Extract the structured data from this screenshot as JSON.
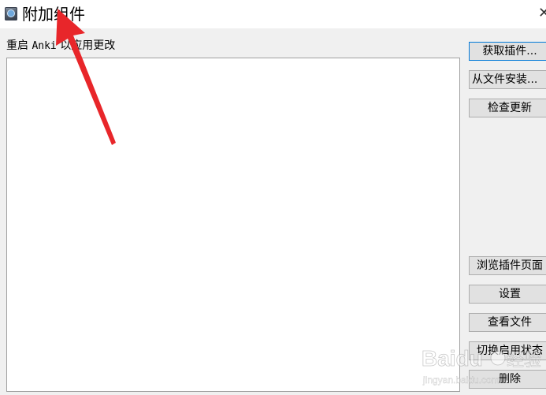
{
  "window": {
    "title": "附加组件",
    "close_glyph": "✕"
  },
  "main": {
    "restart_note_prefix": "重启 ",
    "restart_note_app": "Anki",
    "restart_note_suffix": " 以应用更改"
  },
  "buttons": {
    "get_addons": "获取插件...",
    "install_from_file": "从文件安装...",
    "check_updates": "检查更新",
    "browse_addons": "浏览插件页面",
    "config": "设置",
    "view_files": "查看文件",
    "toggle_enabled": "切换启用状态",
    "delete": "删除"
  },
  "overlay": {
    "arrow_color": "#e8262a",
    "watermark_brand": "Baidu",
    "watermark_cn": "经验",
    "watermark_url": "jingyan.baidu.com"
  }
}
